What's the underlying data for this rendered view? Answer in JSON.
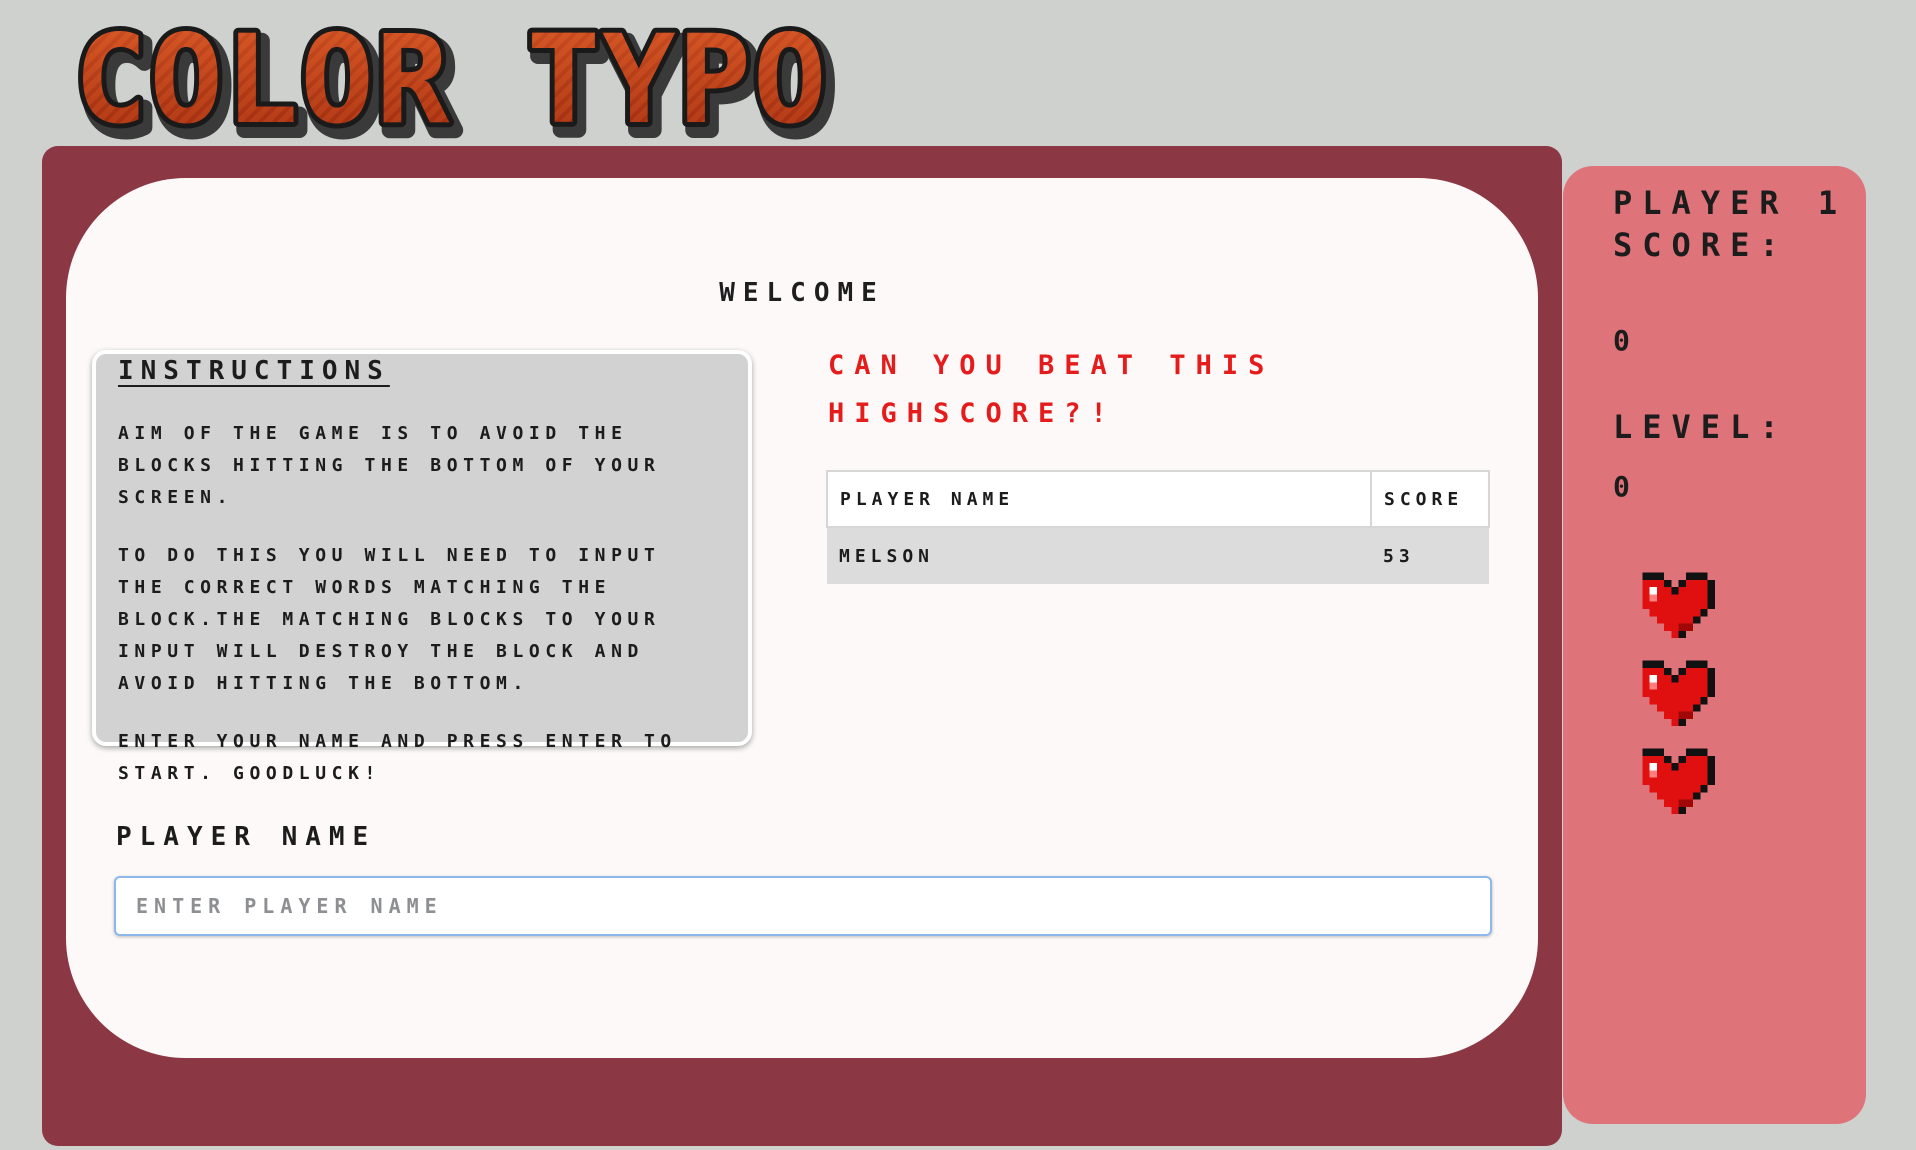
{
  "logo": {
    "text": "COLOR TYPO"
  },
  "main": {
    "welcome": "Welcome",
    "instructions": {
      "title": "Instructions",
      "paragraphs": [
        "Aim of the game is to avoid the blocks hitting the bottom of your screen.",
        "To do this you will need to input the correct words matching the block.The matching blocks to your input will destroy the block and avoid hitting the bottom.",
        "Enter your name and press enter to start. Goodluck!"
      ]
    },
    "highscore": {
      "title": "Can you beat this highscore?!",
      "columns": [
        "Player Name",
        "Score"
      ],
      "rows": [
        {
          "name": "Melson",
          "score": "53"
        }
      ]
    },
    "player_name": {
      "label": "Player Name",
      "placeholder": "Enter player name",
      "value": ""
    }
  },
  "stats": {
    "score_label": "Player 1 Score:",
    "score_value": "0",
    "level_label": "Level:",
    "level_value": "0",
    "lives": 3
  },
  "colors": {
    "background": "#cfd1cf",
    "main_panel": "#8b3844",
    "card": "#fdf9f9",
    "stats_panel": "#de747a",
    "highscore_text": "#e41c1c",
    "heart": "#e01010",
    "logo_fill": "#d24a1c"
  }
}
